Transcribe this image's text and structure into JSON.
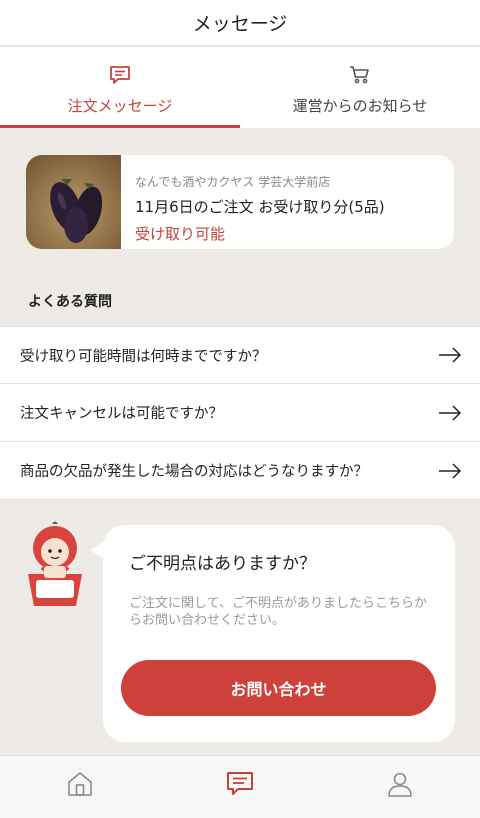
{
  "header": {
    "title": "メッセージ"
  },
  "tabs": [
    {
      "label": "注文メッセージ",
      "icon": "message-icon",
      "active": true
    },
    {
      "label": "運営からのお知らせ",
      "icon": "cart-icon",
      "active": false
    }
  ],
  "order": {
    "shop": "なんでも酒やカクヤス 学芸大学前店",
    "title": "11月6日のご注文 お受け取り分(5品)",
    "status": "受け取り可能",
    "image": "eggplant-photo"
  },
  "faq": {
    "heading": "よくある質問",
    "items": [
      {
        "text": "受け取り可能時間は何時までですか？"
      },
      {
        "text": "注文キャンセルは可能ですか？"
      },
      {
        "text": "商品の欠品が発生した場合の対応はどうなりますか？"
      }
    ]
  },
  "help": {
    "title": "ご不明点はありますか？",
    "description": "ご注文に関して、ご不明点がありましたらこちらからお問い合わせください。",
    "button": "お問い合わせ"
  },
  "bottom_nav": [
    {
      "icon": "home-icon",
      "active": false
    },
    {
      "icon": "message-icon",
      "active": true
    },
    {
      "icon": "profile-icon",
      "active": false
    }
  ],
  "colors": {
    "accent": "#c8413b",
    "background": "#eeebe6",
    "muted": "#9a9a9a"
  }
}
